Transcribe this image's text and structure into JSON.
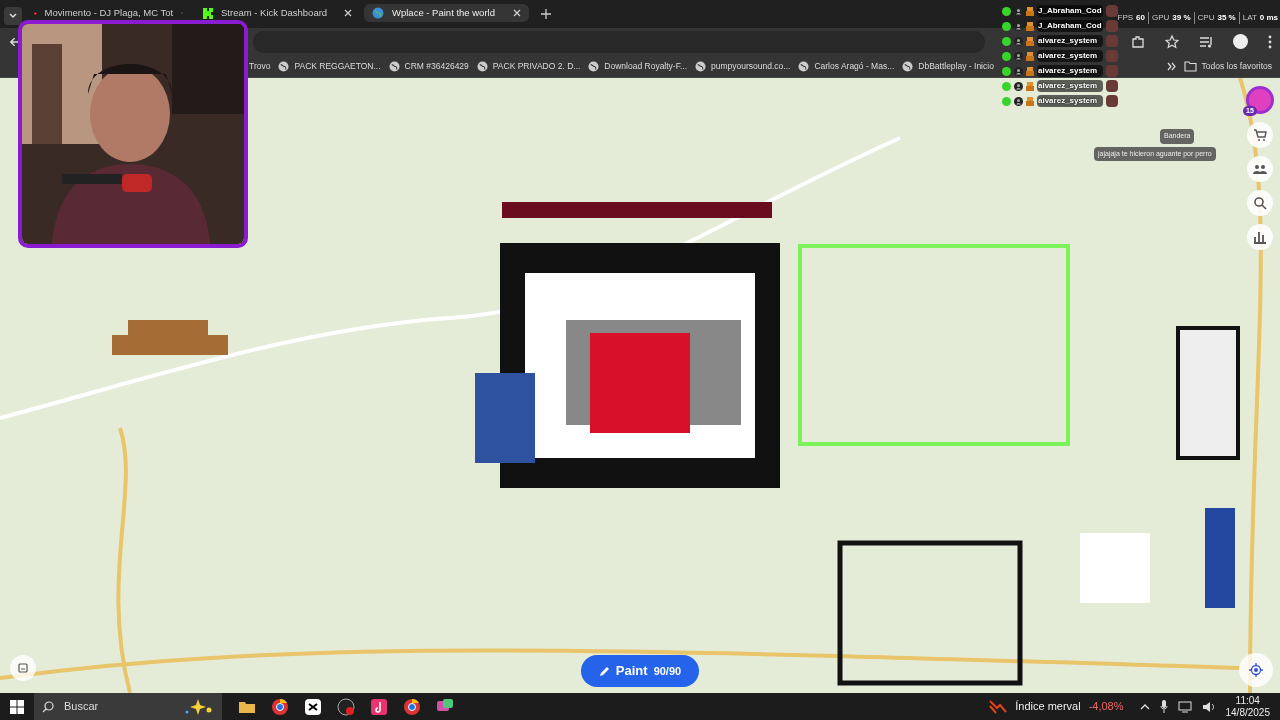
{
  "browser": {
    "tabs": [
      {
        "title": "Movimento - DJ Plaga, MC Tot",
        "kind": "video",
        "selected": false
      },
      {
        "title": "Stream - Kick Dashboard",
        "kind": "kick",
        "selected": false
      },
      {
        "title": "Wplace - Paint the world",
        "kind": "globe",
        "selected": true
      }
    ],
    "bookmarks": [
      "Trovo",
      "PACK REGGAETON...",
      "CRM #36426429",
      "PACK PRIVADO 2. D...",
      "Download Royalty-F...",
      "pumpyoursound.co...",
      "Carlos Aragó - Mas...",
      "DbBattleplay - Inicio"
    ],
    "all_bookmarks": "Todos los favoritos"
  },
  "webcam": {
    "kind": "picture"
  },
  "stream_stats": [
    {
      "label": "FPS",
      "value": "60"
    },
    {
      "label": "GPU",
      "value": "39 %"
    },
    {
      "label": "CPU",
      "value": "35 %"
    },
    {
      "label": "LAT",
      "value": "0 ms"
    }
  ],
  "chat": [
    {
      "user": "J_Abraham_Cod"
    },
    {
      "user": "J_Abraham_Cod"
    },
    {
      "user": "alvarez_system"
    },
    {
      "user": "alvarez_system"
    },
    {
      "user": "alvarez_system"
    },
    {
      "user": "alvarez_system"
    },
    {
      "user": "alvarez_system"
    }
  ],
  "chat_messages": [
    "Bandera",
    "jajajaja te hicieron aguante por perro"
  ],
  "map": {
    "kind": "picture",
    "profile_badge": "15",
    "paint_button": {
      "label": "Paint",
      "count": "90/90"
    }
  },
  "taskbar": {
    "search_placeholder": "Buscar",
    "widget": {
      "label": "Índice merval",
      "change": "-4,08%"
    },
    "time": "11:04",
    "date": "14/8/2025"
  }
}
